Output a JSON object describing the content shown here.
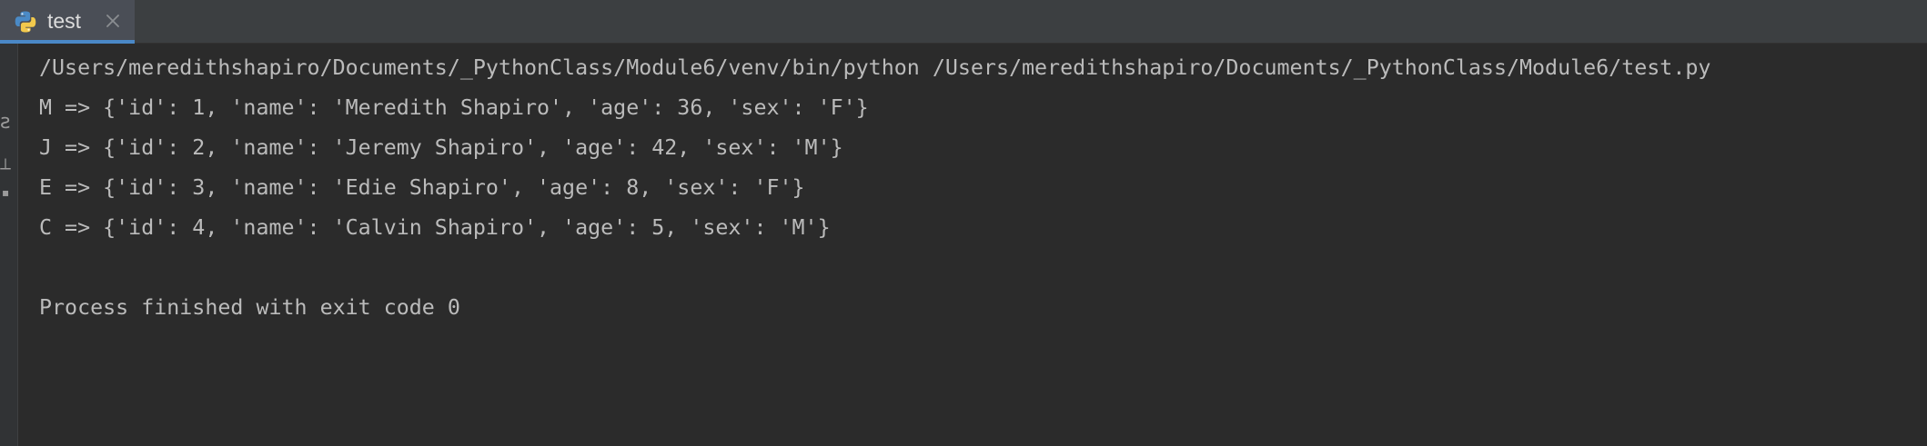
{
  "tab": {
    "label": "test",
    "icon": "python-icon",
    "close_icon": "close-icon",
    "underline_color": "#4a88c7"
  },
  "console": {
    "command": "/Users/meredithshapiro/Documents/_PythonClass/Module6/venv/bin/python /Users/meredithshapiro/Documents/_PythonClass/Module6/test.py",
    "lines": [
      "M => {'id': 1, 'name': 'Meredith Shapiro', 'age': 36, 'sex': 'F'}",
      "J => {'id': 2, 'name': 'Jeremy Shapiro', 'age': 42, 'sex': 'M'}",
      "E => {'id': 3, 'name': 'Edie Shapiro', 'age': 8, 'sex': 'F'}",
      "C => {'id': 4, 'name': 'Calvin Shapiro', 'age': 5, 'sex': 'M'}"
    ],
    "exit_message": "Process finished with exit code 0",
    "text_color": "#bbbbbb",
    "background_color": "#2b2b2b"
  },
  "gutter": {
    "icons": [
      "rerun-icon",
      "scroll-icon",
      "pin-icon"
    ]
  }
}
